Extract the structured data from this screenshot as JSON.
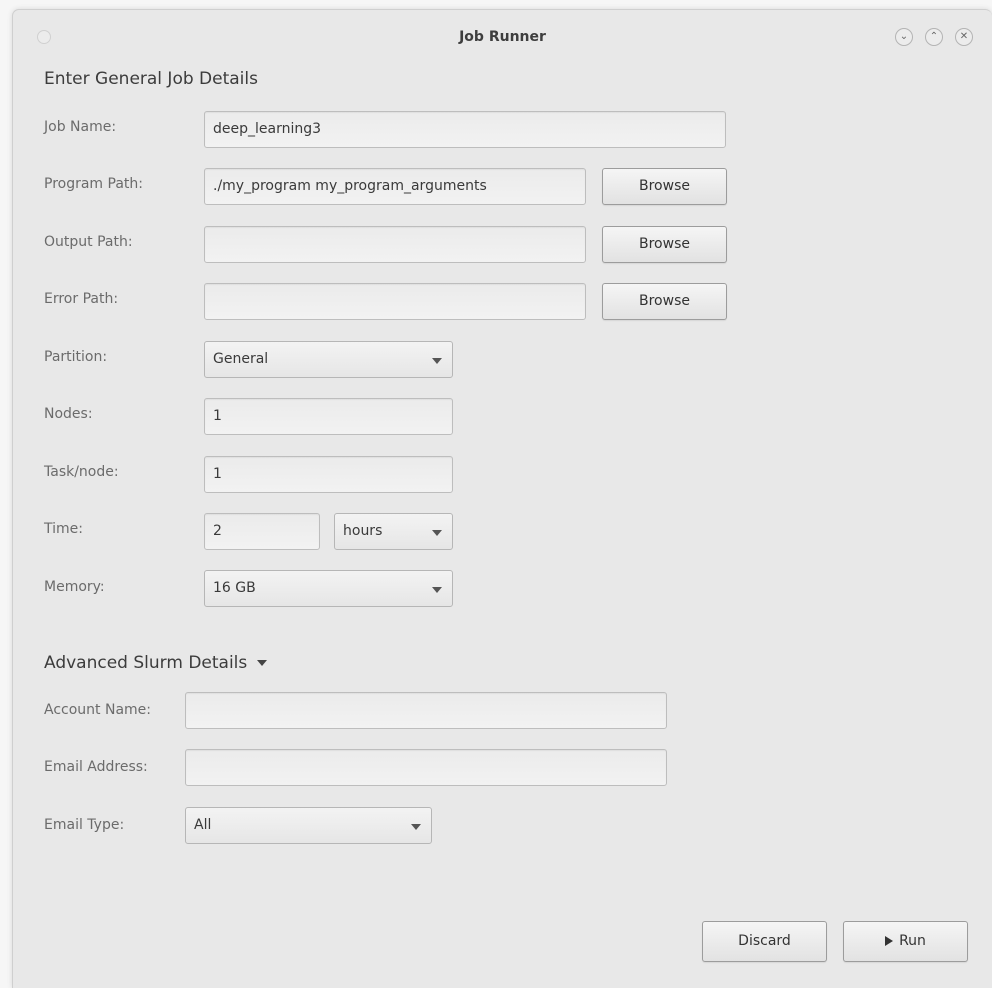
{
  "window": {
    "title": "Job Runner"
  },
  "general": {
    "heading": "Enter General Job Details",
    "job_name": {
      "label": "Job Name:",
      "value": "deep_learning3"
    },
    "program_path": {
      "label": "Program Path:",
      "value": "./my_program my_program_arguments",
      "browse": "Browse"
    },
    "output_path": {
      "label": "Output Path:",
      "value": "",
      "browse": "Browse"
    },
    "error_path": {
      "label": "Error Path:",
      "value": "",
      "browse": "Browse"
    },
    "partition": {
      "label": "Partition:",
      "value": "General"
    },
    "nodes": {
      "label": "Nodes:",
      "value": "1"
    },
    "task_node": {
      "label": "Task/node:",
      "value": "1"
    },
    "time": {
      "label": "Time:",
      "value": "2",
      "unit": "hours"
    },
    "memory": {
      "label": "Memory:",
      "value": "16 GB"
    }
  },
  "advanced": {
    "heading": "Advanced Slurm Details",
    "account_name": {
      "label": "Account Name:",
      "value": ""
    },
    "email_address": {
      "label": "Email Address:",
      "value": ""
    },
    "email_type": {
      "label": "Email Type:",
      "value": "All"
    }
  },
  "actions": {
    "discard": "Discard",
    "run": "Run"
  },
  "icons": {
    "minimize": "chevron-down-icon",
    "maximize": "chevron-up-icon",
    "close": "close-icon",
    "dropdown": "caret-down-icon",
    "run": "play-icon"
  }
}
